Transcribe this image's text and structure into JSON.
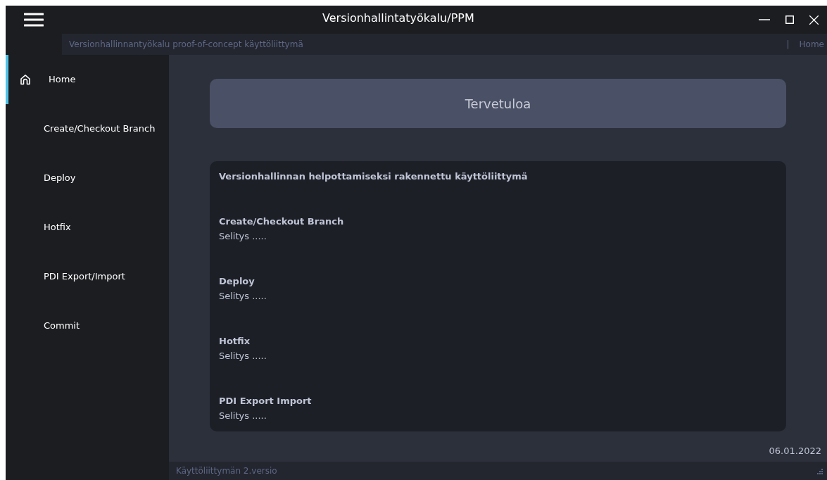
{
  "window": {
    "title": "Versionhallintatyökalu/PPM"
  },
  "subtitle": "Versionhallinnantyökalu proof-of-concept käyttöliittymä",
  "breadcrumb": {
    "separator": "|",
    "current": "Home"
  },
  "sidebar": {
    "items": [
      {
        "label": "Home",
        "selected": true,
        "kind": "home"
      },
      {
        "label": "Create/Checkout Branch",
        "selected": false
      },
      {
        "label": "Deploy",
        "selected": false
      },
      {
        "label": "Hotfix",
        "selected": false
      },
      {
        "label": "PDI Export/Import",
        "selected": false
      },
      {
        "label": "Commit",
        "selected": false
      }
    ]
  },
  "banner": "Tervetuloa",
  "info": {
    "heading": "Versionhallinnan helpottamiseksi rakennettu käyttöliittymä",
    "sections": [
      {
        "title": "Create/Checkout Branch",
        "text": "Selitys ....."
      },
      {
        "title": "Deploy",
        "text": "Selitys ....."
      },
      {
        "title": "Hotfix",
        "text": "Selitys ....."
      },
      {
        "title": "PDI Export Import",
        "text": "Selitys ....."
      }
    ]
  },
  "date": "06.01.2022",
  "status_bar": "Käyttöliittymän 2.versio"
}
